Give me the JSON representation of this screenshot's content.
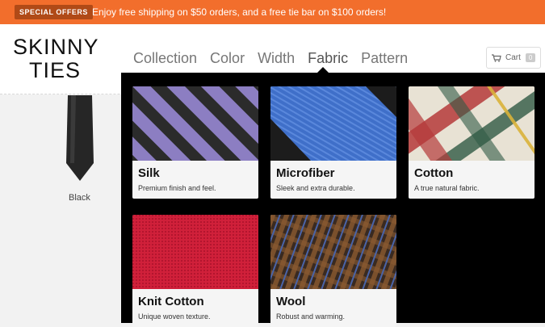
{
  "promo": {
    "badge": "SPECIAL OFFERS",
    "message": "Enjoy free shipping on $50 orders, and a free tie bar on $100 orders!"
  },
  "logo": {
    "line1": "SKINNY",
    "line2": "TIES"
  },
  "nav": {
    "items": [
      {
        "label": "Collection"
      },
      {
        "label": "Color"
      },
      {
        "label": "Width"
      },
      {
        "label": "Fabric",
        "active": true
      },
      {
        "label": "Pattern"
      }
    ]
  },
  "cart": {
    "label": "Cart",
    "count": "0",
    "icon": "cart-icon"
  },
  "product": {
    "label": "Black"
  },
  "fabrics": [
    {
      "title": "Silk",
      "desc": "Premium finish and feel."
    },
    {
      "title": "Microfiber",
      "desc": "Sleek and extra durable."
    },
    {
      "title": "Cotton",
      "desc": "A true natural fabric."
    },
    {
      "title": "Knit Cotton",
      "desc": "Unique woven texture."
    },
    {
      "title": "Wool",
      "desc": "Robust and warming."
    }
  ],
  "colors": {
    "promo": "#f26e2c",
    "megamenu": "#000000"
  }
}
